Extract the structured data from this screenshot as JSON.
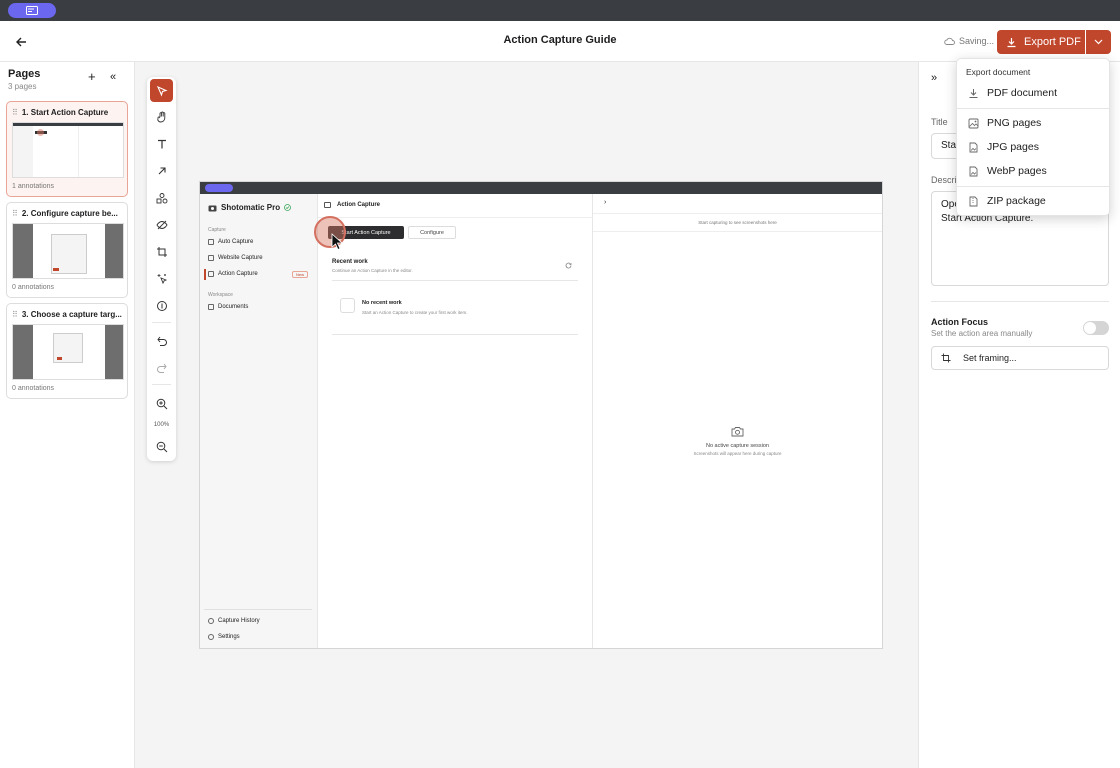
{
  "header": {
    "title": "Action Capture Guide",
    "saving_label": "Saving...",
    "export_label": "Export PDF"
  },
  "pages_panel": {
    "title": "Pages",
    "count": "3 pages",
    "pages": [
      {
        "title": "1. Start Action Capture",
        "annotations": "1 annotations"
      },
      {
        "title": "2. Configure capture be...",
        "annotations": "0 annotations"
      },
      {
        "title": "3. Choose a capture targ...",
        "annotations": "0 annotations"
      }
    ]
  },
  "toolbar": {
    "zoom_label": "100%"
  },
  "screenshot": {
    "brand": "Shotomatic Pro",
    "section_capture": "Capture",
    "items": [
      "Auto Capture",
      "Website Capture",
      "Action Capture"
    ],
    "new_badge": "New",
    "section_workspace": "Workspace",
    "workspace_items": [
      "Documents"
    ],
    "footer_items": [
      "Capture History",
      "Settings"
    ],
    "header_title": "Action Capture",
    "start_button": "Start Action Capture",
    "configure_button": "Configure",
    "recent_title": "Recent work",
    "recent_sub": "Continue an Action Capture in the editor.",
    "no_recent_title": "No recent work",
    "no_recent_sub": "Start an Action Capture to create your first work item.",
    "right_message": "Start capturing to see screenshots here",
    "empty_title": "No active capture session",
    "empty_sub": "Screenshots will appear here during capture"
  },
  "properties": {
    "title_label": "Title",
    "title_value": "Sta",
    "description_label": "Descri",
    "description_line1": "Ope",
    "description_line2": "Start Action Capture.",
    "action_focus_title": "Action Focus",
    "action_focus_sub": "Set the action area manually",
    "action_focus_on": false,
    "framing_button": "Set framing..."
  },
  "export_menu": {
    "heading": "Export document",
    "items": [
      "PDF document",
      "PNG pages",
      "JPG pages",
      "WebP pages",
      "ZIP package"
    ]
  },
  "colors": {
    "accent": "#c0462c",
    "os_pill": "#6b67ee"
  }
}
